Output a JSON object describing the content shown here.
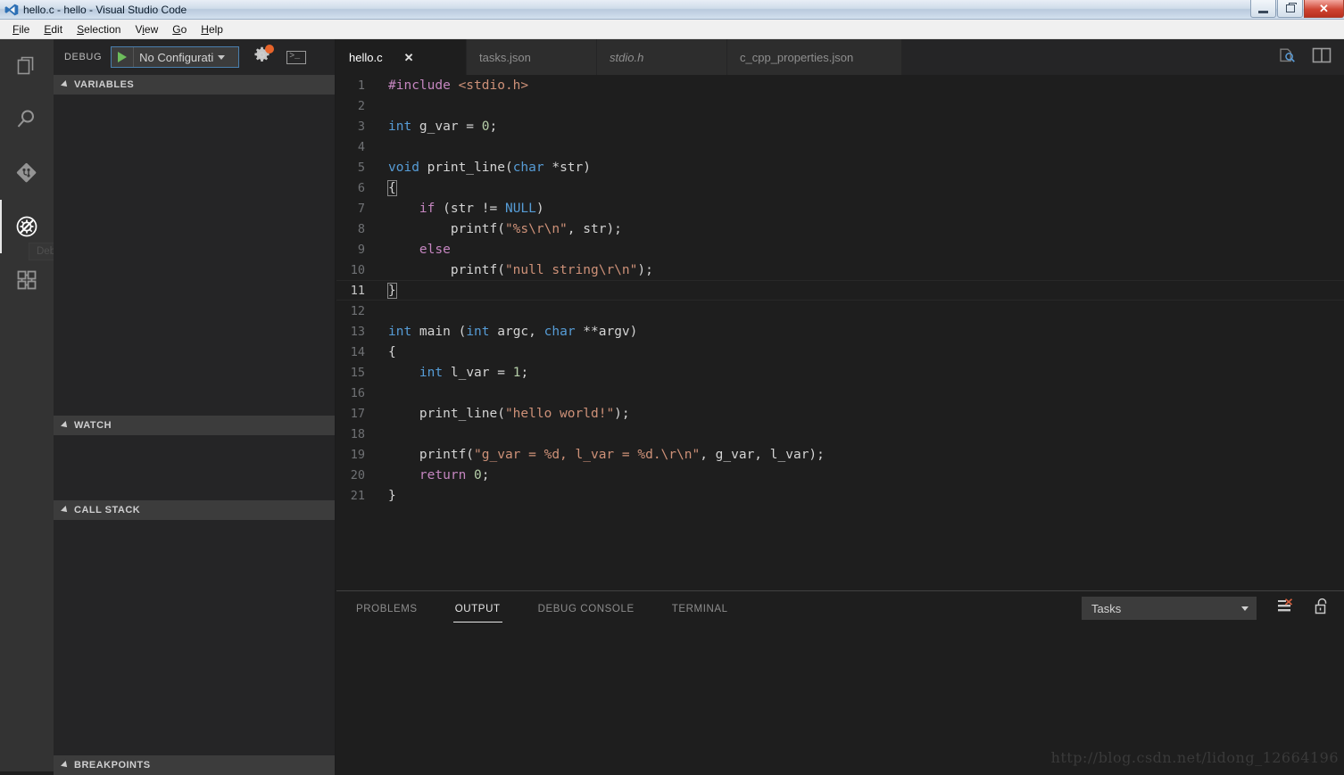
{
  "window": {
    "title": "hello.c - hello - Visual Studio Code",
    "logo_icon": "vscode-logo-icon",
    "controls": {
      "minimize_label": "Minimize",
      "maximize_label": "Maximize",
      "close_label": "Close"
    }
  },
  "menubar": {
    "items": [
      {
        "label": "File",
        "mnemonic": "F"
      },
      {
        "label": "Edit",
        "mnemonic": "E"
      },
      {
        "label": "Selection",
        "mnemonic": "S"
      },
      {
        "label": "View",
        "mnemonic": "V"
      },
      {
        "label": "Go",
        "mnemonic": "G"
      },
      {
        "label": "Help",
        "mnemonic": "H"
      }
    ]
  },
  "activitybar": {
    "items": [
      {
        "name": "explorer",
        "icon": "files-icon",
        "active": false
      },
      {
        "name": "search",
        "icon": "search-icon",
        "active": false
      },
      {
        "name": "source-control",
        "icon": "source-control-icon",
        "active": false
      },
      {
        "name": "debug",
        "icon": "debug-icon",
        "active": true
      },
      {
        "name": "extensions",
        "icon": "extensions-icon",
        "active": false
      }
    ],
    "tooltip": "Debug (Ctrl+Shift+D)"
  },
  "sidebar": {
    "toolbar": {
      "debug_label": "DEBUG",
      "start_icon": "play-icon",
      "configuration": "No Configurati",
      "dropdown_icon": "chevron-down-icon",
      "settings_icon": "gear-icon",
      "settings_badge": true,
      "console_icon": "terminal-icon"
    },
    "sections": [
      {
        "title": "VARIABLES",
        "collapsed": false
      },
      {
        "title": "WATCH",
        "collapsed": false
      },
      {
        "title": "CALL STACK",
        "collapsed": false
      },
      {
        "title": "BREAKPOINTS",
        "collapsed": false
      }
    ]
  },
  "editor": {
    "tabs": [
      {
        "label": "hello.c",
        "active": true,
        "preview": false,
        "close_icon": "close-icon"
      },
      {
        "label": "tasks.json",
        "active": false,
        "preview": false
      },
      {
        "label": "stdio.h",
        "active": false,
        "preview": true
      },
      {
        "label": "c_cpp_properties.json",
        "active": false,
        "preview": false
      }
    ],
    "actions": [
      {
        "name": "open-preview",
        "icon": "preview-icon"
      },
      {
        "name": "split-editor",
        "icon": "split-editor-icon"
      }
    ],
    "language": "c",
    "current_line": 11,
    "lines": [
      {
        "n": 1,
        "tokens": [
          {
            "t": "#include ",
            "c": "pre"
          },
          {
            "t": "<stdio.h>",
            "c": "inc"
          }
        ]
      },
      {
        "n": 2,
        "tokens": []
      },
      {
        "n": 3,
        "tokens": [
          {
            "t": "int",
            "c": "key"
          },
          {
            "t": " g_var = ",
            "c": "plain"
          },
          {
            "t": "0",
            "c": "num"
          },
          {
            "t": ";",
            "c": "plain"
          }
        ]
      },
      {
        "n": 4,
        "tokens": []
      },
      {
        "n": 5,
        "tokens": [
          {
            "t": "void",
            "c": "key"
          },
          {
            "t": " print_line(",
            "c": "plain"
          },
          {
            "t": "char",
            "c": "key"
          },
          {
            "t": " *str)",
            "c": "plain"
          }
        ]
      },
      {
        "n": 6,
        "tokens": [
          {
            "t": "{",
            "c": "brace"
          }
        ]
      },
      {
        "n": 7,
        "tokens": [
          {
            "t": "    ",
            "c": "plain"
          },
          {
            "t": "if",
            "c": "ctl"
          },
          {
            "t": " (str != ",
            "c": "plain"
          },
          {
            "t": "NULL",
            "c": "const"
          },
          {
            "t": ")",
            "c": "plain"
          }
        ]
      },
      {
        "n": 8,
        "tokens": [
          {
            "t": "        printf(",
            "c": "plain"
          },
          {
            "t": "\"%s\\r\\n\"",
            "c": "str"
          },
          {
            "t": ", str);",
            "c": "plain"
          }
        ]
      },
      {
        "n": 9,
        "tokens": [
          {
            "t": "    ",
            "c": "plain"
          },
          {
            "t": "else",
            "c": "ctl"
          }
        ]
      },
      {
        "n": 10,
        "tokens": [
          {
            "t": "        printf(",
            "c": "plain"
          },
          {
            "t": "\"null string\\r\\n\"",
            "c": "str"
          },
          {
            "t": ");",
            "c": "plain"
          }
        ]
      },
      {
        "n": 11,
        "tokens": [
          {
            "t": "}",
            "c": "brace"
          }
        ]
      },
      {
        "n": 12,
        "tokens": []
      },
      {
        "n": 13,
        "tokens": [
          {
            "t": "int",
            "c": "key"
          },
          {
            "t": " main (",
            "c": "plain"
          },
          {
            "t": "int",
            "c": "key"
          },
          {
            "t": " argc, ",
            "c": "plain"
          },
          {
            "t": "char",
            "c": "key"
          },
          {
            "t": " **argv)",
            "c": "plain"
          }
        ]
      },
      {
        "n": 14,
        "tokens": [
          {
            "t": "{",
            "c": "plain"
          }
        ]
      },
      {
        "n": 15,
        "tokens": [
          {
            "t": "    ",
            "c": "plain"
          },
          {
            "t": "int",
            "c": "key"
          },
          {
            "t": " l_var = ",
            "c": "plain"
          },
          {
            "t": "1",
            "c": "num"
          },
          {
            "t": ";",
            "c": "plain"
          }
        ]
      },
      {
        "n": 16,
        "tokens": []
      },
      {
        "n": 17,
        "tokens": [
          {
            "t": "    print_line(",
            "c": "plain"
          },
          {
            "t": "\"hello world!\"",
            "c": "str"
          },
          {
            "t": ");",
            "c": "plain"
          }
        ]
      },
      {
        "n": 18,
        "tokens": []
      },
      {
        "n": 19,
        "tokens": [
          {
            "t": "    printf(",
            "c": "plain"
          },
          {
            "t": "\"g_var = %d, l_var = %d.\\r\\n\"",
            "c": "str"
          },
          {
            "t": ", g_var, l_var);",
            "c": "plain"
          }
        ]
      },
      {
        "n": 20,
        "tokens": [
          {
            "t": "    ",
            "c": "plain"
          },
          {
            "t": "return",
            "c": "ctl"
          },
          {
            "t": " ",
            "c": "plain"
          },
          {
            "t": "0",
            "c": "num"
          },
          {
            "t": ";",
            "c": "plain"
          }
        ]
      },
      {
        "n": 21,
        "tokens": [
          {
            "t": "}",
            "c": "plain"
          }
        ]
      }
    ]
  },
  "panel": {
    "tabs": [
      {
        "label": "PROBLEMS",
        "active": false
      },
      {
        "label": "OUTPUT",
        "active": true
      },
      {
        "label": "DEBUG CONSOLE",
        "active": false
      },
      {
        "label": "TERMINAL",
        "active": false
      }
    ],
    "channel_select": {
      "value": "Tasks",
      "dropdown_icon": "chevron-down-icon"
    },
    "actions": [
      {
        "name": "clear-output",
        "icon": "clear-output-icon"
      },
      {
        "name": "lock-scroll",
        "icon": "unlock-icon"
      }
    ],
    "output_text": ""
  },
  "watermark": "http://blog.csdn.net/lidong_12664196",
  "colors": {
    "editor_background": "#1e1e1e",
    "sidebar_background": "#252526",
    "activitybar_background": "#333333",
    "section_header_background": "#3c3c3c",
    "accent_focus_border": "#4a7fae",
    "badge_orange": "#e8642a",
    "play_green": "#6dbd5c",
    "keyword_blue": "#569cd6",
    "control_purple": "#c586c0",
    "string_orange": "#ce9178",
    "number_green": "#b5cea8",
    "text_foreground": "#d4d4d4"
  }
}
